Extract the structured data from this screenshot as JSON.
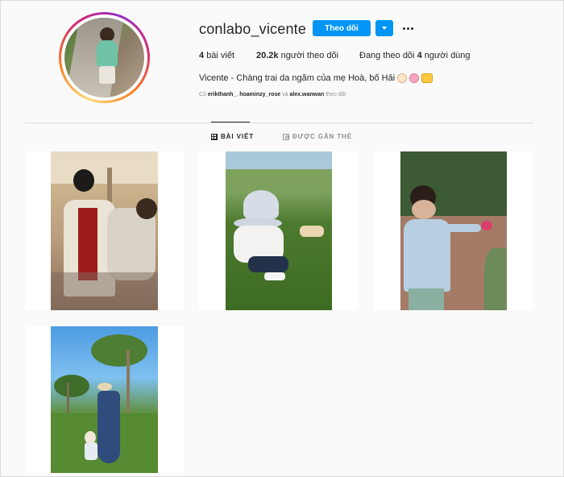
{
  "profile": {
    "username": "conlabo_vicente",
    "follow_button": "Theo dõi",
    "stats": {
      "posts_count": "4",
      "posts_label": "bài viết",
      "followers_count": "20.2k",
      "followers_label": "người theo dõi",
      "following_prefix": "Đang theo dõi",
      "following_count": "4",
      "following_label": "người dùng"
    },
    "bio": "Vicente - Chàng trai da ngăm của mẹ Hoà, bố Hải",
    "bio_emojis": [
      "baby-face",
      "pig-face",
      "family"
    ],
    "followed_by": {
      "prefix": "Có",
      "user1": "erikthanh_",
      "user2": "hoaminzy_rose",
      "conj": "và",
      "user3": "alex.wanwan",
      "suffix": "theo dõi"
    }
  },
  "tabs": [
    {
      "label": "BÀI VIẾT",
      "icon": "grid-icon",
      "active": true
    },
    {
      "label": "ĐƯỢC GẮN THẺ",
      "icon": "tag-icon",
      "active": false
    }
  ],
  "posts": [
    {
      "description": "father holding child in kitchen"
    },
    {
      "description": "toddler with bucket hat sitting on grass"
    },
    {
      "description": "boy in blue shirt touching flowers"
    },
    {
      "description": "mother and child under palm trees"
    }
  ],
  "colors": {
    "accent": "#0095f6",
    "text": "#262626",
    "muted": "#8e8e8e",
    "background": "#fafafa"
  }
}
